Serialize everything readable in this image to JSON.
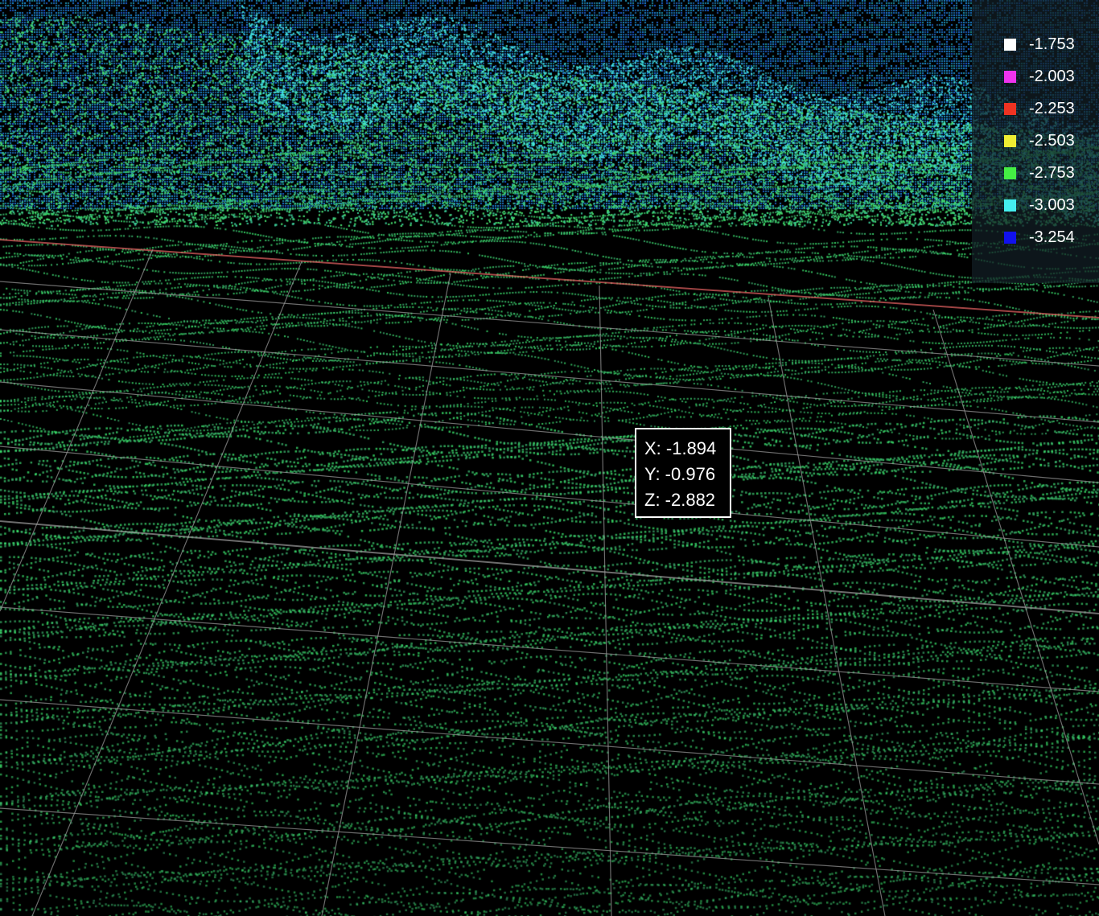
{
  "legend": {
    "items": [
      {
        "label": "-1.753",
        "color": "#ffffff"
      },
      {
        "label": "-2.003",
        "color": "#ee33ee"
      },
      {
        "label": "-2.253",
        "color": "#ee3322"
      },
      {
        "label": "-2.503",
        "color": "#eeee33"
      },
      {
        "label": "-2.753",
        "color": "#44ee44"
      },
      {
        "label": "-3.003",
        "color": "#44eeee"
      },
      {
        "label": "-3.254",
        "color": "#1111ee"
      }
    ]
  },
  "tooltip": {
    "x": "X: -1.894",
    "y": "Y: -0.976",
    "z": "Z: -2.882"
  },
  "colors": {
    "background": "#000000",
    "near_points": "#3fd870",
    "mid_points": "#46e046",
    "far_points": "#1e7ae0",
    "ridge_points": "#40e8e0",
    "grid": "#9a9a9a",
    "axis_x": "#e06060"
  }
}
